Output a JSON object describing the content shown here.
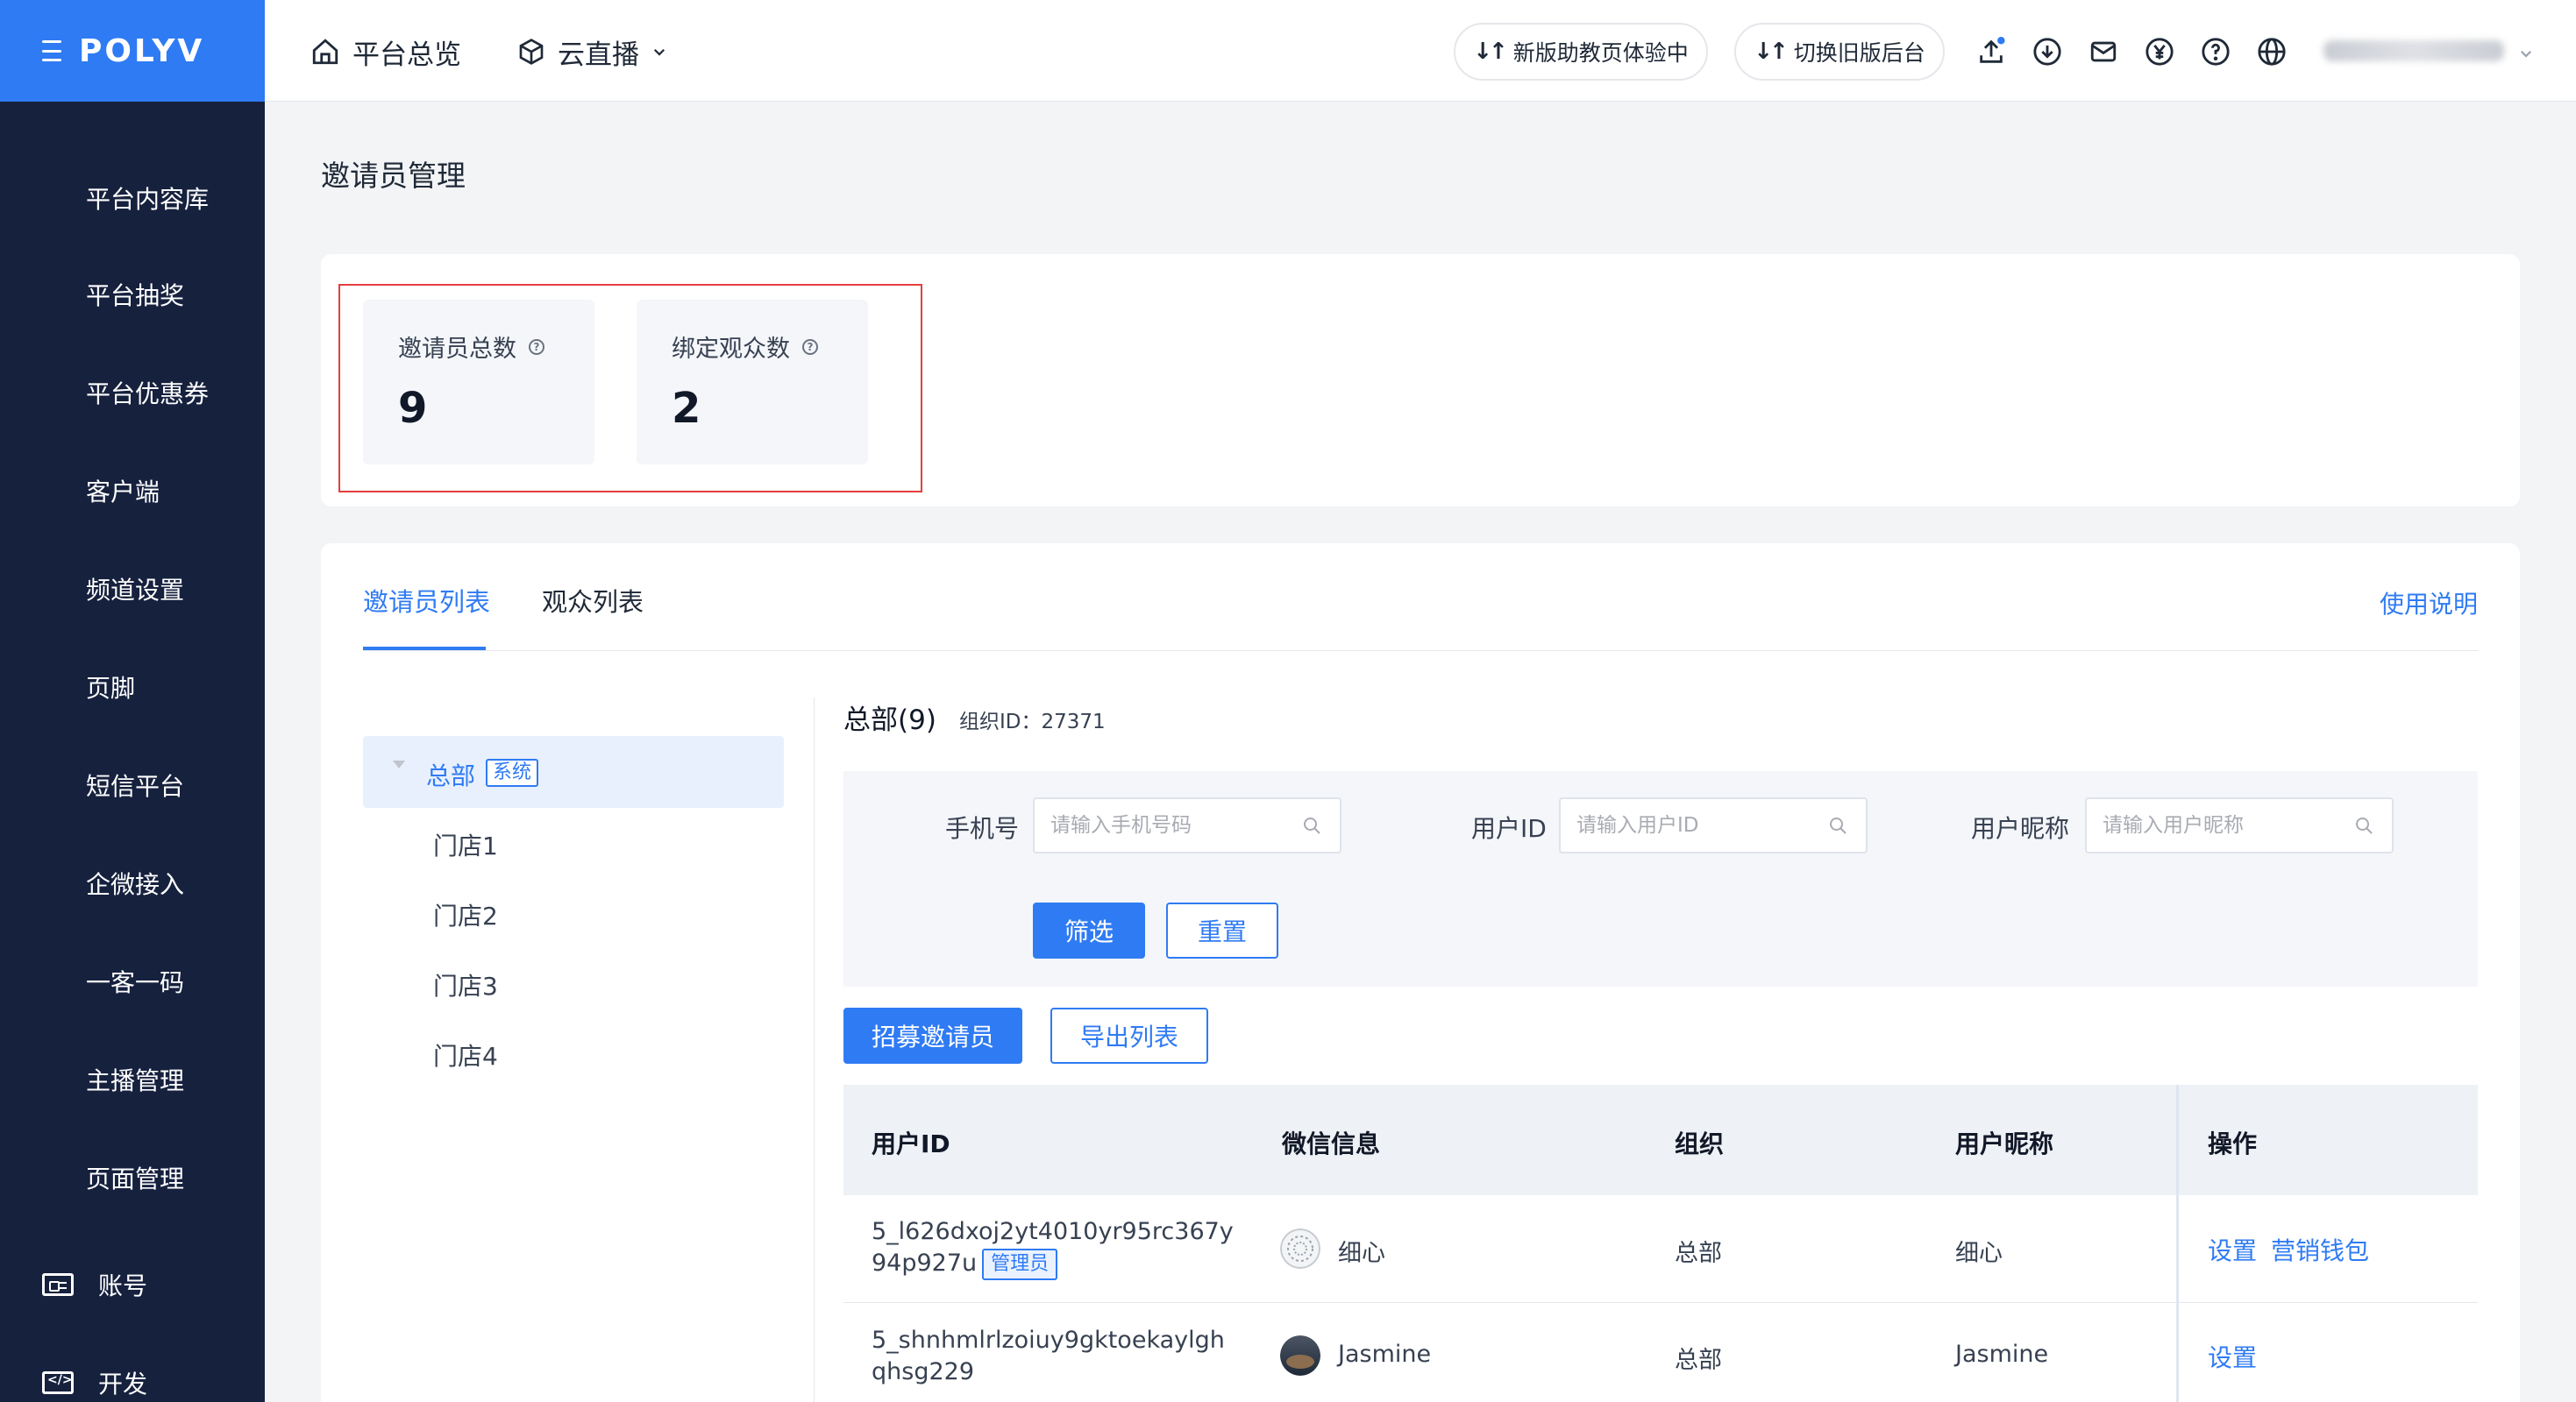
{
  "brand": {
    "logo": "POLYV",
    "primary_color": "#2f7bf3",
    "sidebar_color": "#16213e"
  },
  "sidebar": {
    "items": [
      {
        "label": "平台内容库"
      },
      {
        "label": "平台抽奖"
      },
      {
        "label": "平台优惠券"
      },
      {
        "label": "客户端"
      },
      {
        "label": "频道设置"
      },
      {
        "label": "页脚"
      },
      {
        "label": "短信平台"
      },
      {
        "label": "企微接入"
      },
      {
        "label": "一客一码"
      },
      {
        "label": "主播管理"
      },
      {
        "label": "页面管理"
      },
      {
        "label": "账号",
        "icon": "id-card-icon"
      },
      {
        "label": "开发",
        "icon": "code-icon"
      }
    ]
  },
  "header": {
    "nav_overview": "平台总览",
    "nav_live": "云直播",
    "btn_new_assistant": "新版助教页体验中",
    "btn_switch_old": "切换旧版后台",
    "tool_icons": [
      "upload-icon",
      "download-icon",
      "mail-icon",
      "yen-icon",
      "help-icon",
      "globe-icon"
    ]
  },
  "page": {
    "title": "邀请员管理",
    "stats": [
      {
        "label": "邀请员总数",
        "value": "9"
      },
      {
        "label": "绑定观众数",
        "value": "2"
      }
    ],
    "tabs": [
      {
        "label": "邀请员列表",
        "active": true
      },
      {
        "label": "观众列表",
        "active": false
      }
    ],
    "help_link": "使用说明",
    "tree": {
      "root": {
        "label": "总部",
        "tag": "系统"
      },
      "children": [
        "门店1",
        "门店2",
        "门店3",
        "门店4"
      ]
    },
    "org": {
      "title": "总部(9)",
      "id_text": "组织ID：27371"
    },
    "filters": {
      "phone_label": "手机号",
      "phone_placeholder": "请输入手机号码",
      "userid_label": "用户ID",
      "userid_placeholder": "请输入用户ID",
      "nickname_label": "用户昵称",
      "nickname_placeholder": "请输入用户昵称",
      "filter_btn": "筛选",
      "reset_btn": "重置"
    },
    "actions": {
      "recruit": "招募邀请员",
      "export": "导出列表"
    },
    "table": {
      "columns": [
        "用户ID",
        "微信信息",
        "组织",
        "用户昵称",
        "操作"
      ],
      "rows": [
        {
          "user_id": "5_l626dxoj2yt4010yr95rc367y94p927u",
          "admin_tag": "管理员",
          "wechat": "细心",
          "org": "总部",
          "nickname": "细心",
          "actions": [
            "设置",
            "营销钱包"
          ]
        },
        {
          "user_id": "5_shnhmlrlzoiuy9gktoekaylghqhsg229",
          "admin_tag": "",
          "wechat": "Jasmine",
          "org": "总部",
          "nickname": "Jasmine",
          "actions": [
            "设置"
          ]
        }
      ]
    }
  }
}
